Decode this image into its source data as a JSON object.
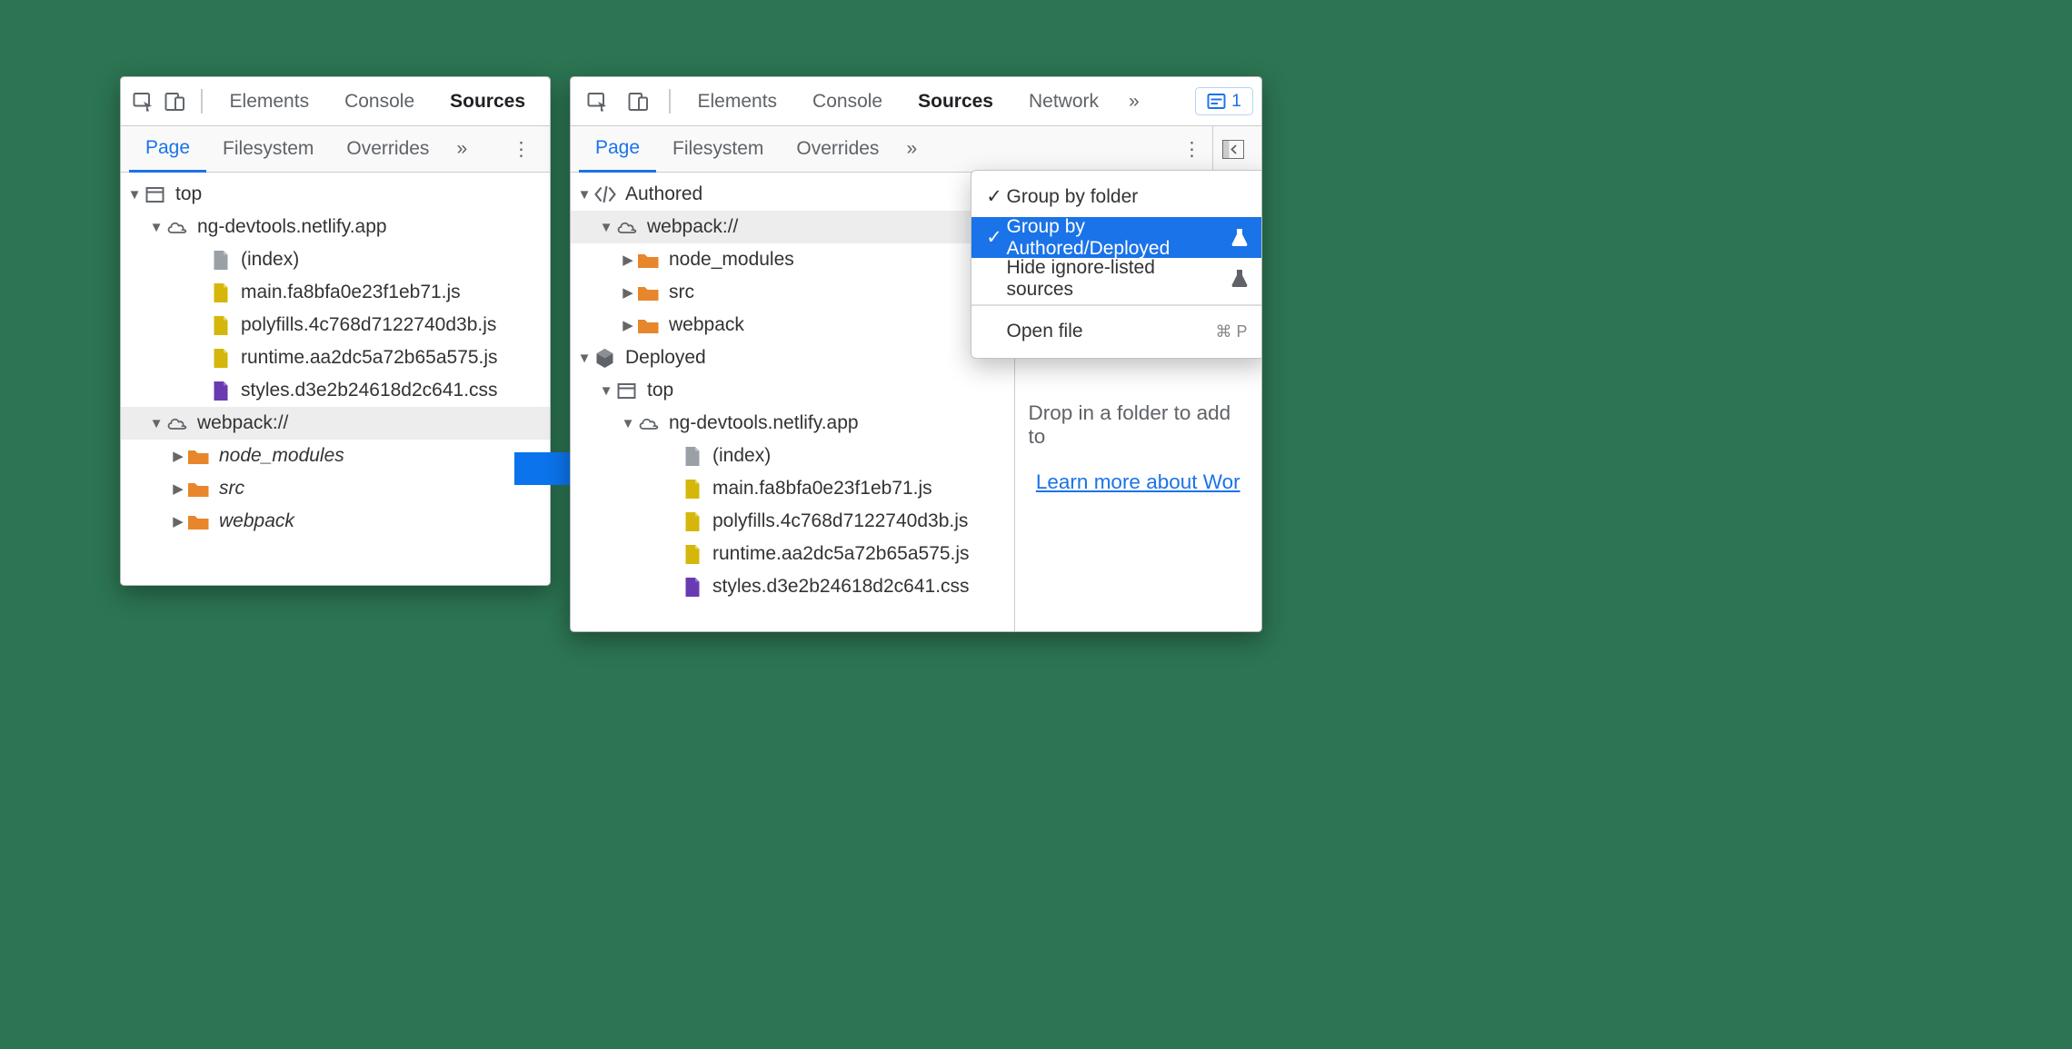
{
  "left": {
    "main_tabs": {
      "elements": "Elements",
      "console": "Console",
      "sources": "Sources"
    },
    "sub_tabs": {
      "page": "Page",
      "filesystem": "Filesystem",
      "overrides": "Overrides"
    },
    "tree": {
      "top": "top",
      "domain": "ng-devtools.netlify.app",
      "index": "(index)",
      "main": "main.fa8bfa0e23f1eb71.js",
      "polyfills": "polyfills.4c768d7122740d3b.js",
      "runtime": "runtime.aa2dc5a72b65a575.js",
      "styles": "styles.d3e2b24618d2c641.css",
      "webpack": "webpack://",
      "node_modules": "node_modules",
      "src": "src",
      "wp_folder": "webpack"
    }
  },
  "right": {
    "main_tabs": {
      "elements": "Elements",
      "console": "Console",
      "sources": "Sources",
      "network": "Network"
    },
    "issues": "1",
    "sub_tabs": {
      "page": "Page",
      "filesystem": "Filesystem",
      "overrides": "Overrides"
    },
    "tree": {
      "authored": "Authored",
      "webpack": "webpack://",
      "node_modules": "node_modules",
      "src": "src",
      "wp_folder": "webpack",
      "deployed": "Deployed",
      "top": "top",
      "domain": "ng-devtools.netlify.app",
      "index": "(index)",
      "main": "main.fa8bfa0e23f1eb71.js",
      "polyfills": "polyfills.4c768d7122740d3b.js",
      "runtime": "runtime.aa2dc5a72b65a575.js",
      "styles": "styles.d3e2b24618d2c641.css"
    },
    "ctx": {
      "group_folder": "Group by folder",
      "group_authored": "Group by Authored/Deployed",
      "hide_ignore": "Hide ignore-listed sources",
      "open_file": "Open file",
      "open_file_kbd": "⌘ P"
    },
    "drop_hint": "Drop in a folder to add to",
    "learn_more": "Learn more about Wor"
  }
}
